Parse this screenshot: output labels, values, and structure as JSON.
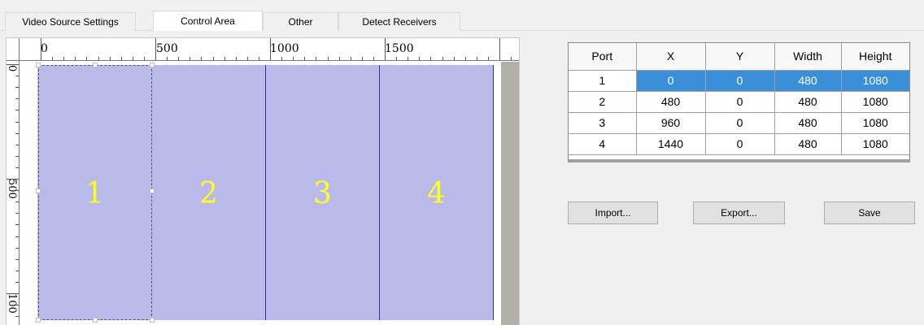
{
  "tabs": [
    {
      "label": "Video Source Settings",
      "active": false
    },
    {
      "label": "Control Area",
      "active": true
    },
    {
      "label": "Other",
      "active": false
    },
    {
      "label": "Detect Receivers",
      "active": false
    }
  ],
  "ruler": {
    "horizontal_labels": [
      "0",
      "500",
      "1000",
      "1500"
    ],
    "vertical_labels": [
      "0",
      "500",
      "100"
    ]
  },
  "canvas": {
    "region_color": "#b9b9ea",
    "label_color": "#ffff1f",
    "outside_color": "#b3b0a6",
    "regions": [
      {
        "label": "1",
        "selected": true
      },
      {
        "label": "2",
        "selected": false
      },
      {
        "label": "3",
        "selected": false
      },
      {
        "label": "4",
        "selected": false
      }
    ]
  },
  "table": {
    "headers": [
      "Port",
      "X",
      "Y",
      "Width",
      "Height"
    ],
    "rows": [
      [
        "1",
        "0",
        "0",
        "480",
        "1080"
      ],
      [
        "2",
        "480",
        "0",
        "480",
        "1080"
      ],
      [
        "3",
        "960",
        "0",
        "480",
        "1080"
      ],
      [
        "4",
        "1440",
        "0",
        "480",
        "1080"
      ]
    ],
    "selected_row": 0,
    "selection_color": "#3b8fd8"
  },
  "buttons": {
    "import": "Import...",
    "export": "Export...",
    "save": "Save"
  }
}
